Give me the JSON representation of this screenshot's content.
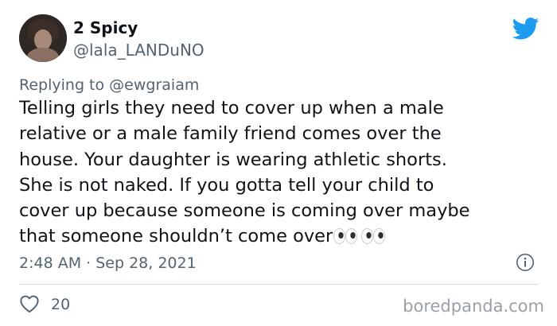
{
  "author": {
    "display_name": "2 Spicy",
    "handle": "@lala_LANDuNO"
  },
  "reply": {
    "prefix": "Replying to",
    "mention": "@ewgraiam"
  },
  "tweet": {
    "text": "Telling girls they need to cover up when a male\nrelative or a male family friend comes over the\nhouse. Your daughter is wearing athletic shorts.\nShe is not naked. If you gotta tell your child to\ncover up because someone is coming over maybe\nthat someone shouldn’t come over",
    "emoji": "eyes-emoji-x2",
    "timestamp": "2:48 AM · Sep 28, 2021",
    "like_count": "20"
  },
  "icons": {
    "brand": "twitter-bird-icon",
    "info": "info-icon",
    "like": "heart-icon"
  },
  "colors": {
    "twitter_blue": "#1d9bf0",
    "secondary_text": "#536471"
  },
  "watermark": "boredpanda.com"
}
